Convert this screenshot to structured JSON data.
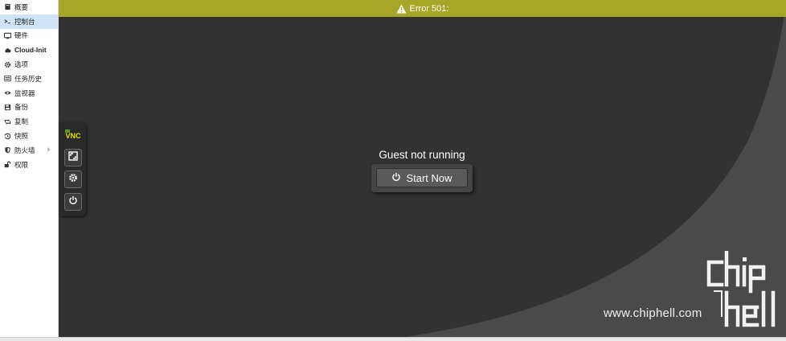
{
  "sidebar": {
    "items": [
      {
        "label": "概要",
        "icon": "book-icon",
        "active": false
      },
      {
        "label": "控制台",
        "icon": "terminal-icon",
        "active": true
      },
      {
        "label": "硬件",
        "icon": "monitor-icon",
        "active": false
      },
      {
        "label": "Cloud-Init",
        "icon": "cloud-icon",
        "active": false
      },
      {
        "label": "选项",
        "icon": "gear-icon",
        "active": false
      },
      {
        "label": "任务历史",
        "icon": "list-icon",
        "active": false
      },
      {
        "label": "监视器",
        "icon": "eye-icon",
        "active": false
      },
      {
        "label": "备份",
        "icon": "floppy-icon",
        "active": false
      },
      {
        "label": "复制",
        "icon": "retweet-icon",
        "active": false
      },
      {
        "label": "快照",
        "icon": "history-icon",
        "active": false
      },
      {
        "label": "防火墙",
        "icon": "shield-icon",
        "active": false
      },
      {
        "label": "权限",
        "icon": "unlock-icon",
        "active": false
      }
    ]
  },
  "error_bar": {
    "text": "Error 501:",
    "icon": "warning-icon",
    "color": "#a8a628"
  },
  "vnc": {
    "logo": "VNC",
    "buttons": [
      "fullscreen-icon",
      "gear-icon",
      "power-icon"
    ]
  },
  "console": {
    "status": "Guest not running",
    "start_label": "Start Now"
  },
  "watermark": {
    "logo": "chiphell",
    "url": "www.chiphell.com"
  },
  "colors": {
    "main_bg": "#323232",
    "curve_bg": "#4a4a4a",
    "active_item": "#cfe3f6"
  }
}
